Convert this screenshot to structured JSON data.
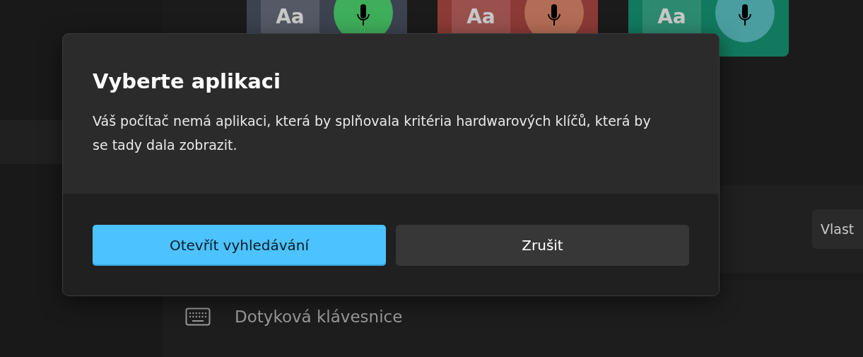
{
  "tiles": [
    {
      "sample": "Aa",
      "color": "#3d4250",
      "badge": {
        "color": "#3fae5a"
      }
    },
    {
      "sample": "Aa",
      "color": "#8c3a36",
      "badge": {
        "color": "#b36c55"
      }
    },
    {
      "sample": "Aa",
      "color": "#117a5e",
      "badge": {
        "color": "#4a9e9f"
      }
    }
  ],
  "settings": {
    "button": "Vlast",
    "keyboard_item": "Dotyková klávesnice"
  },
  "dialog": {
    "title": "Vyberte aplikaci",
    "message": "Váš počítač nemá aplikaci, která by splňovala kritéria hardwarových klíčů, která by se tady dala zobrazit.",
    "buttons": [
      {
        "label": "Otevřít vyhledávání",
        "kind": "primary"
      },
      {
        "label": "Zrušit",
        "kind": "secondary"
      }
    ]
  }
}
